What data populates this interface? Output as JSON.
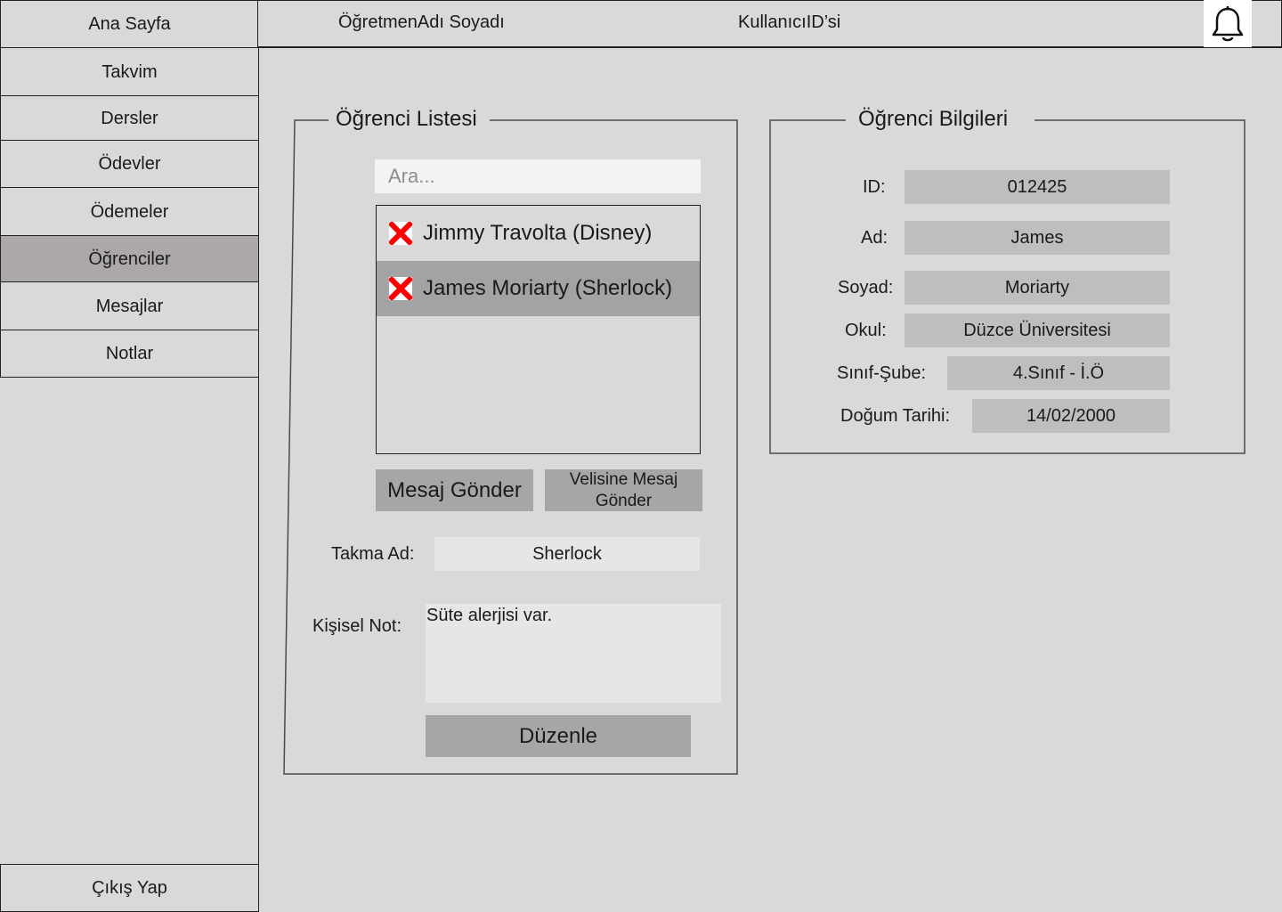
{
  "sidebar": {
    "items": [
      {
        "label": "Ana Sayfa"
      },
      {
        "label": "Takvim"
      },
      {
        "label": "Dersler"
      },
      {
        "label": "Ödevler"
      },
      {
        "label": "Ödemeler"
      },
      {
        "label": "Öğrenciler",
        "active": true
      },
      {
        "label": "Mesajlar"
      },
      {
        "label": "Notlar"
      }
    ],
    "logout_label": "Çıkış Yap"
  },
  "header": {
    "teacher_name": "ÖğretmenAdı Soyadı",
    "user_id": "KullanıcıID’si",
    "notification_icon": "bell-icon"
  },
  "student_list": {
    "title": "Öğrenci Listesi",
    "search_placeholder": "Ara...",
    "items": [
      {
        "name": "Jimmy Travolta (Disney)",
        "icon": "remove-x-icon"
      },
      {
        "name": "James Moriarty (Sherlock)",
        "icon": "remove-x-icon",
        "selected": true
      }
    ],
    "send_message_label": "Mesaj Gönder",
    "send_parent_message_label": "Velisine Mesaj Gönder",
    "nickname_label": "Takma Ad:",
    "nickname_value": "Sherlock",
    "personal_note_label": "Kişisel Not:",
    "personal_note_value": "Süte alerjisi var.",
    "edit_label": "Düzenle"
  },
  "student_info": {
    "title": "Öğrenci Bilgileri",
    "id_label": "ID:",
    "id_value": "012425",
    "name_label": "Ad:",
    "name_value": "James",
    "surname_label": "Soyad:",
    "surname_value": "Moriarty",
    "school_label": "Okul:",
    "school_value": "Düzce Üniversitesi",
    "class_label": "Sınıf-Şube:",
    "class_value": "4.Sınıf - İ.Ö",
    "birth_label": "Doğum Tarihi:",
    "birth_value": "14/02/2000"
  },
  "colors": {
    "background": "#d9d9d9",
    "active_nav": "#aca8a8",
    "button": "#a6a6a6",
    "field": "#bebebe",
    "remove_icon": "#ff0000"
  }
}
